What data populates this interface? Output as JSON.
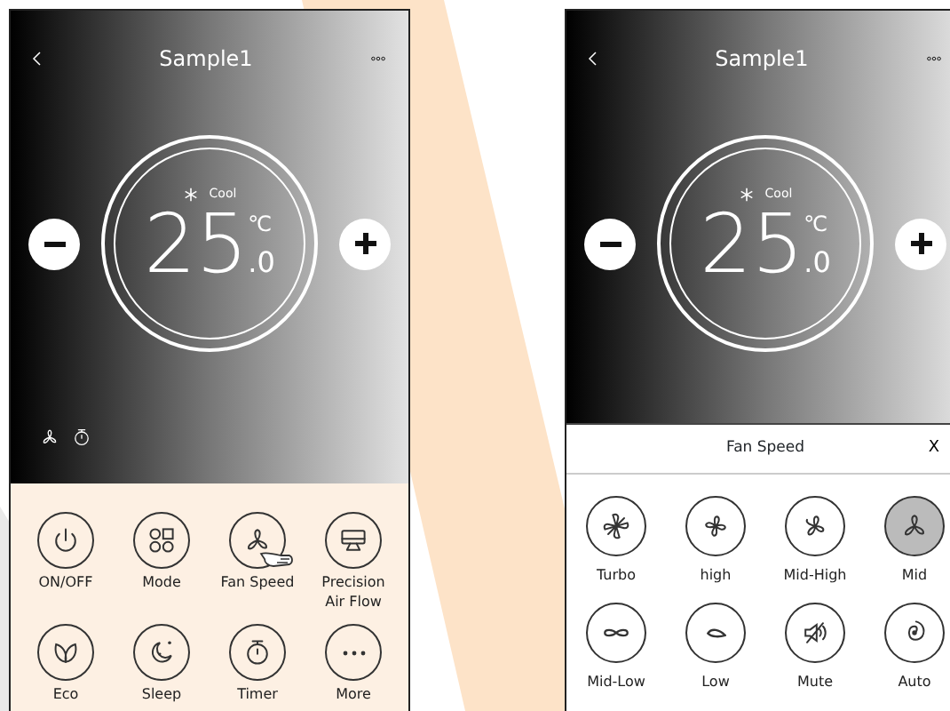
{
  "screens": [
    {
      "title": "Sample1",
      "mode": "Cool",
      "temperature": "25",
      "unit": "℃",
      "decimal": ".0",
      "controls": [
        {
          "label": "ON/OFF",
          "pointer": false
        },
        {
          "label": "Mode",
          "pointer": false
        },
        {
          "label": "Fan Speed",
          "pointer": true
        },
        {
          "label": "Precision Air Flow",
          "pointer": false
        },
        {
          "label": "Eco",
          "pointer": false
        },
        {
          "label": "Sleep",
          "pointer": false
        },
        {
          "label": "Timer",
          "pointer": false
        },
        {
          "label": "More",
          "pointer": false
        }
      ]
    },
    {
      "title": "Sample1",
      "mode": "Cool",
      "temperature": "25",
      "unit": "℃",
      "decimal": ".0",
      "sheet": {
        "title": "Fan Speed",
        "close": "X",
        "options": [
          {
            "label": "Turbo",
            "selected": false
          },
          {
            "label": "high",
            "selected": false
          },
          {
            "label": "Mid-High",
            "selected": false
          },
          {
            "label": "Mid",
            "selected": true
          },
          {
            "label": "Mid-Low",
            "selected": false
          },
          {
            "label": "Low",
            "selected": false
          },
          {
            "label": "Mute",
            "selected": false
          },
          {
            "label": "Auto",
            "selected": false
          }
        ]
      }
    }
  ]
}
